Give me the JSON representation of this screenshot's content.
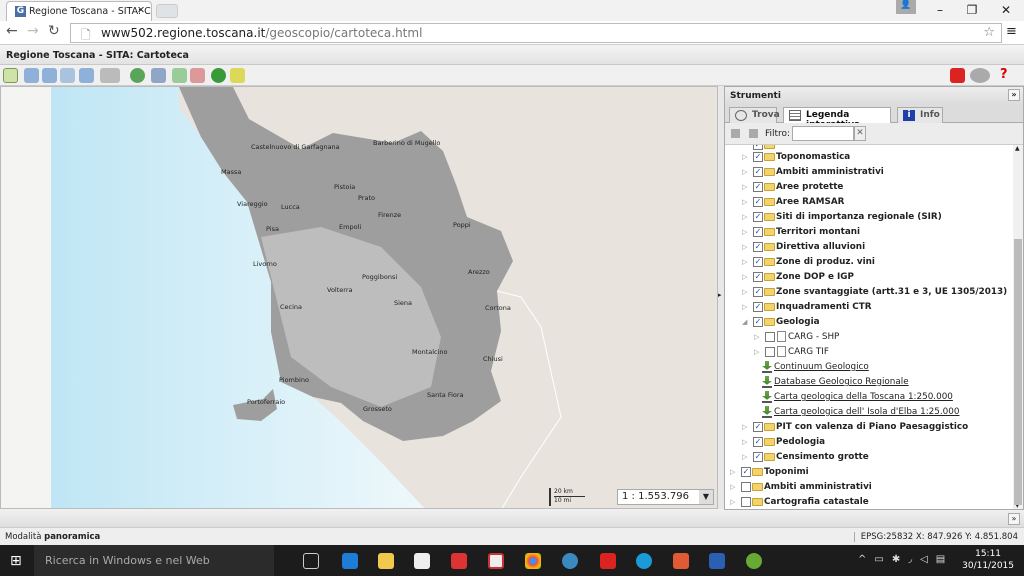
{
  "browser": {
    "tab_title": "Regione Toscana - SITA: C",
    "url_host": "www502.regione.toscana.it",
    "url_path": "/geoscopio/cartoteca.html"
  },
  "page": {
    "title": "Regione Toscana - SITA: Cartoteca"
  },
  "toolbar": {
    "tools": [
      "pan-icon",
      "zoom-in-icon",
      "zoom-out-icon",
      "zoom-box-icon",
      "zoom-extent-icon",
      "measure-icon",
      "history-back-icon",
      "print-icon",
      "select-add-icon",
      "select-remove-icon",
      "globe-icon",
      "pencil-icon"
    ],
    "right_tools": [
      "link-icon",
      "gear-icon",
      "help-icon"
    ]
  },
  "map": {
    "cities": [
      "Castelnuovo di Garfagnana",
      "Massa",
      "Barberino di Mugello",
      "Pistoia",
      "Prato",
      "Viareggio",
      "Lucca",
      "Firenze",
      "Pisa",
      "Empoli",
      "Poppi",
      "Livorno",
      "Poggibonsi",
      "Arezzo",
      "Volterra",
      "Siena",
      "Cecina",
      "Cortona",
      "Montalcino",
      "Chiusi",
      "Piombino",
      "Santa Fiora",
      "Portoferraio",
      "Grosseto"
    ],
    "scale_km": "20 km",
    "scale_mi": "10 mi",
    "scale_value": "1 : 1.553.796",
    "colors": {
      "sea": "#cdebf6",
      "land": "#e8e4dd",
      "tuscany": "#9a9a9a"
    }
  },
  "panel": {
    "title": "Strumenti",
    "tabs": [
      {
        "label": "Trova"
      },
      {
        "label": "Legenda interattiva",
        "active": true
      },
      {
        "label": "Info"
      }
    ],
    "filter_label": "Filtro:",
    "filter_value": "",
    "tree": [
      {
        "label": "Toponomastica",
        "level": 1,
        "checked": true,
        "type": "folder"
      },
      {
        "label": "Ambiti amministrativi",
        "level": 1,
        "checked": true,
        "type": "folder"
      },
      {
        "label": "Aree protette",
        "level": 1,
        "checked": true,
        "type": "folder"
      },
      {
        "label": "Aree RAMSAR",
        "level": 1,
        "checked": true,
        "type": "folder"
      },
      {
        "label": "Siti di importanza regionale (SIR)",
        "level": 1,
        "checked": true,
        "type": "folder"
      },
      {
        "label": "Territori montani",
        "level": 1,
        "checked": true,
        "type": "folder"
      },
      {
        "label": "Direttiva alluvioni",
        "level": 1,
        "checked": true,
        "type": "folder"
      },
      {
        "label": "Zone di produz. vini",
        "level": 1,
        "checked": true,
        "type": "folder"
      },
      {
        "label": "Zone DOP e IGP",
        "level": 1,
        "checked": true,
        "type": "folder"
      },
      {
        "label": "Zone svantaggiate (artt.31 e 3, UE 1305/2013)",
        "level": 1,
        "checked": true,
        "type": "folder"
      },
      {
        "label": "Inquadramenti CTR",
        "level": 1,
        "checked": true,
        "type": "folder"
      },
      {
        "label": "Geologia",
        "level": 1,
        "checked": true,
        "type": "folder",
        "expanded": true
      },
      {
        "label": "CARG - SHP",
        "level": 2,
        "checked": false,
        "type": "layer"
      },
      {
        "label": "CARG TIF",
        "level": 2,
        "checked": false,
        "type": "layer"
      },
      {
        "label": "Continuum Geologico",
        "level": 2,
        "type": "download"
      },
      {
        "label": "Database Geologico Regionale",
        "level": 2,
        "type": "download"
      },
      {
        "label": "Carta geologica della Toscana 1:250.000",
        "level": 2,
        "type": "download"
      },
      {
        "label": "Carta geologica dell' Isola d'Elba 1:25.000",
        "level": 2,
        "type": "download"
      },
      {
        "label": "PIT con valenza di Piano Paesaggistico",
        "level": 1,
        "checked": true,
        "type": "folder"
      },
      {
        "label": "Pedologia",
        "level": 1,
        "checked": true,
        "type": "folder"
      },
      {
        "label": "Censimento grotte",
        "level": 1,
        "checked": true,
        "type": "folder"
      },
      {
        "label": "Toponimi",
        "level": 0,
        "checked": true,
        "type": "folder"
      },
      {
        "label": "Ambiti amministrativi",
        "level": 0,
        "checked": false,
        "type": "folder"
      },
      {
        "label": "Cartografia catastale",
        "level": 0,
        "checked": false,
        "type": "folder"
      }
    ]
  },
  "status": {
    "mode_prefix": "Modalità ",
    "mode": "panoramica",
    "coords": "EPSG:25832  X: 847.926  Y: 4.851.804"
  },
  "taskbar": {
    "search_placeholder": "Ricerca in Windows e nel Web",
    "time": "15:11",
    "date": "30/11/2015"
  }
}
